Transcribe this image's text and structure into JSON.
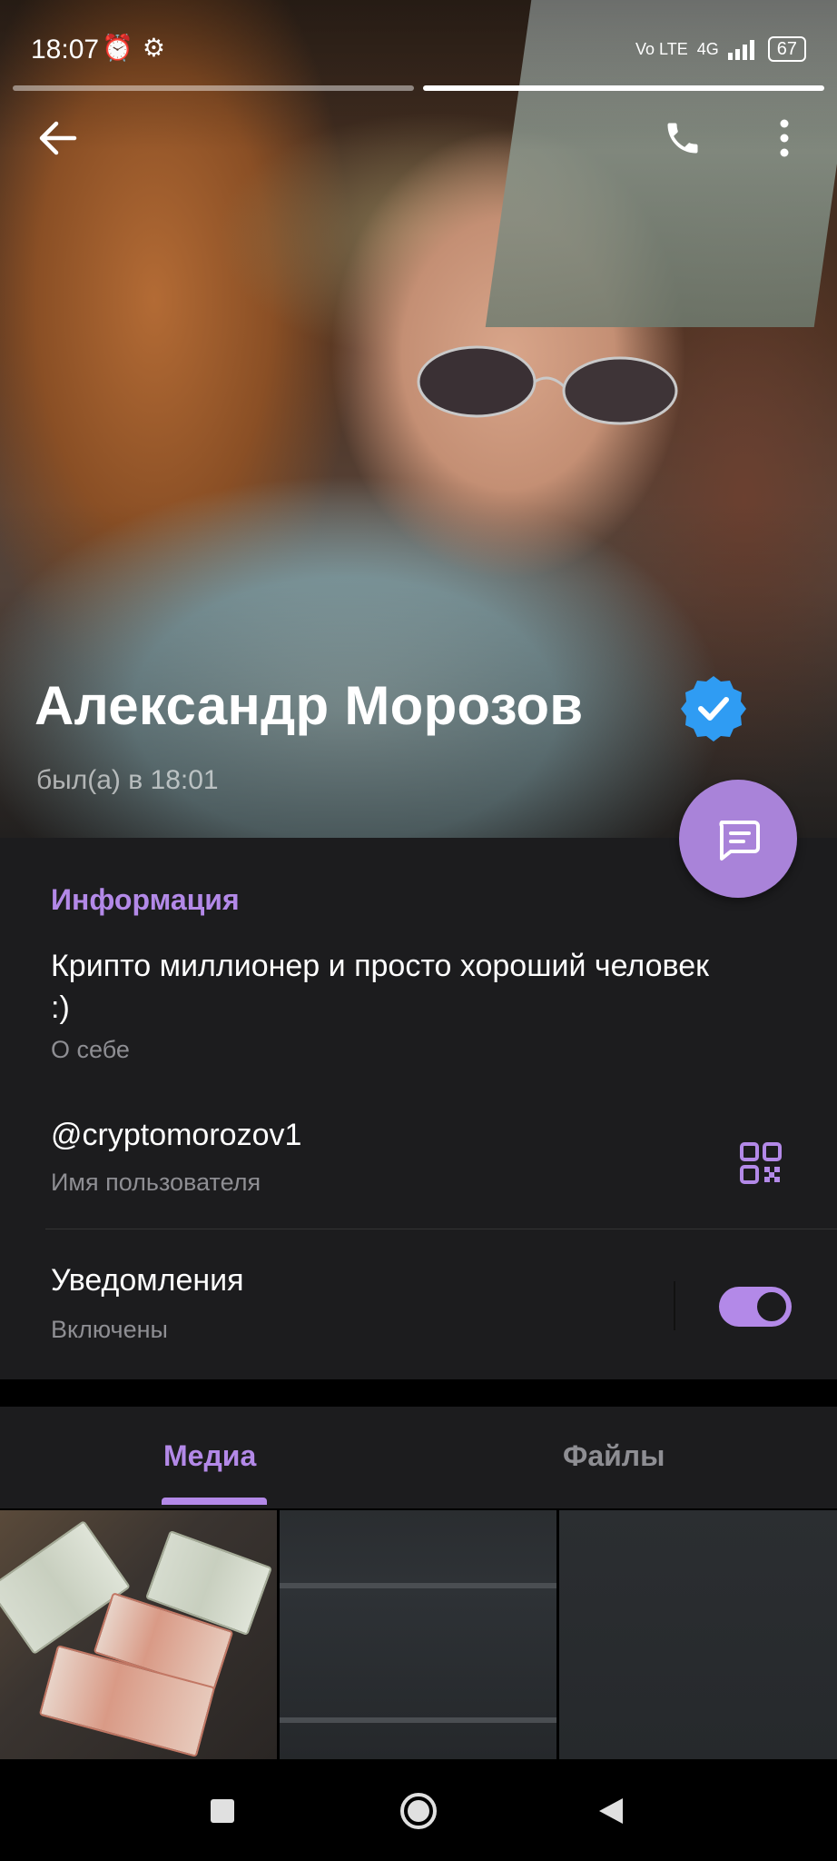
{
  "status_bar": {
    "time": "18:07",
    "alarm_icon": "alarm-clock-icon",
    "app_icon": "notification-icon",
    "network": "4G",
    "volte": "Vo LTE",
    "battery": "67"
  },
  "story": {
    "segments": 2,
    "active_segment": 2
  },
  "toolbar": {
    "back_icon": "arrow-left-icon",
    "call_icon": "phone-icon",
    "more_icon": "more-vertical-icon"
  },
  "profile": {
    "name": "Александр Морозов",
    "verified": true,
    "last_seen": "был(а) в 18:01"
  },
  "info": {
    "section_title": "Информация",
    "bio": "Крипто миллионер и просто хороший человек :)",
    "bio_label": "О себе",
    "username": "@cryptomorozov1",
    "username_label": "Имя пользователя",
    "notifications_label": "Уведомления",
    "notifications_status": "Включены",
    "notifications_on": true
  },
  "tabs": [
    {
      "label": "Медиа",
      "active": true
    },
    {
      "label": "Файлы",
      "active": false
    }
  ],
  "colors": {
    "accent": "#b389e8",
    "fab": "#a983d9",
    "verified_badge": "#2f9cf3",
    "panel_bg": "#1c1c1e",
    "secondary_text": "#8e8e93"
  }
}
